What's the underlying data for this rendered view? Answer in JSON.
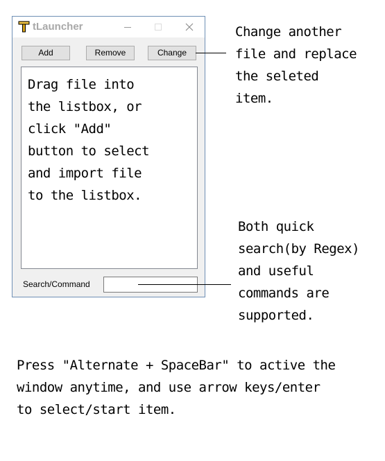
{
  "window": {
    "title": "tLauncher",
    "icon": "t-letter-icon",
    "accent_color": "#d4a017"
  },
  "toolbar": {
    "add_label": "Add",
    "remove_label": "Remove",
    "change_label": "Change"
  },
  "listbox": {
    "hint": "Drag file into\nthe listbox, or\nclick \"Add\"\nbutton to select\nand import file\nto the listbox."
  },
  "search": {
    "label": "Search/Command",
    "value": ""
  },
  "annotations": {
    "change": "Change another\nfile and replace\nthe seleted\nitem.",
    "search": "Both quick\nsearch(by Regex)\nand useful\ncommands are\nsupported.",
    "footer": "Press \"Alternate + SpaceBar\" to active the\nwindow anytime, and use arrow keys/enter\nto select/start item."
  }
}
